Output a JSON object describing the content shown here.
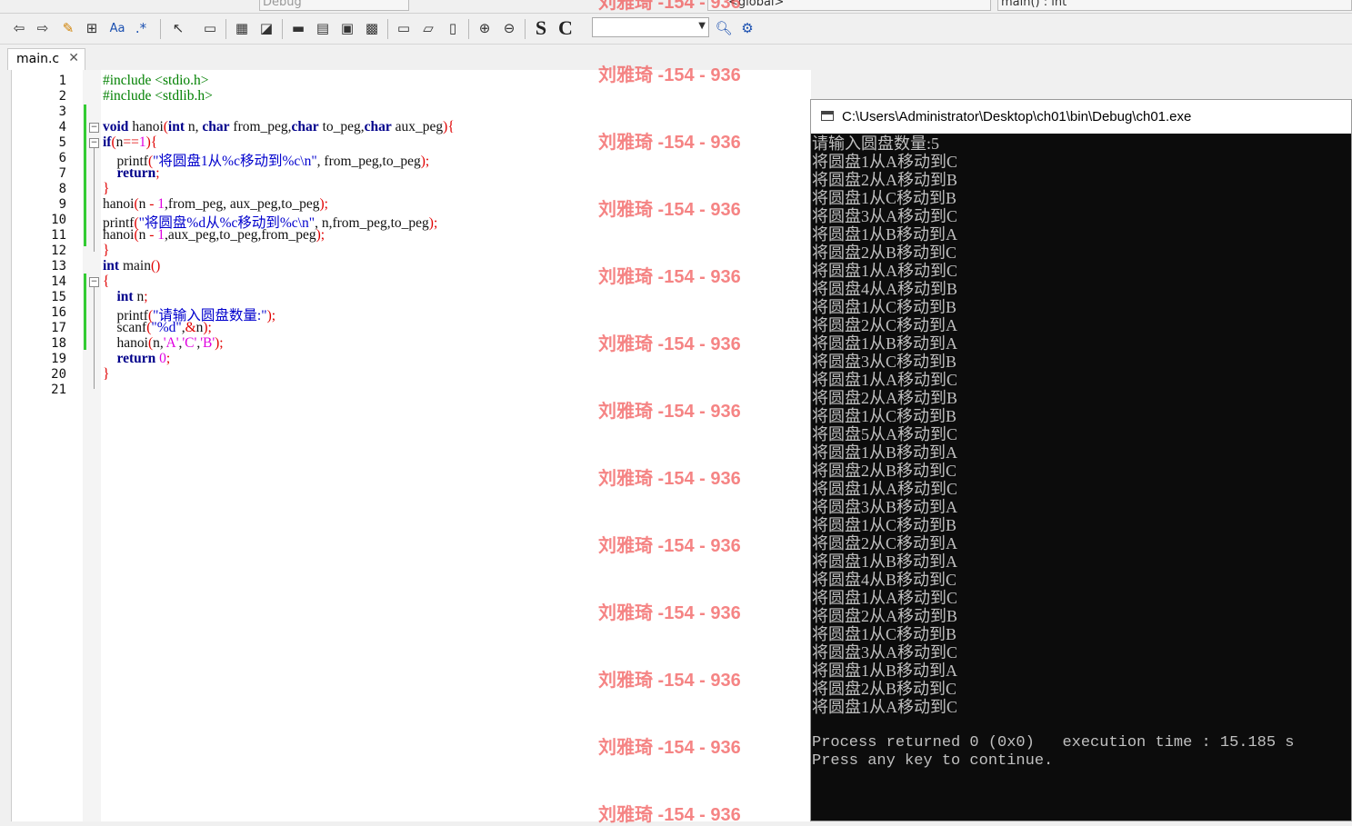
{
  "toolbar1": {
    "build_target": "Debug",
    "scope": "<global>",
    "function": "main() : int"
  },
  "toolbar2": {
    "search_combo": "",
    "buttons": [
      "S",
      "C"
    ]
  },
  "tab": {
    "label": "main.c",
    "close": "✕"
  },
  "editor": {
    "line_numbers": [
      "1",
      "2",
      "3",
      "4",
      "5",
      "6",
      "7",
      "8",
      "9",
      "10",
      "11",
      "12",
      "13",
      "14",
      "15",
      "16",
      "17",
      "18",
      "19",
      "20",
      "21"
    ]
  },
  "watermark": "刘雅琦 -154 - 936",
  "console": {
    "title": "C:\\Users\\Administrator\\Desktop\\ch01\\bin\\Debug\\ch01.exe",
    "lines": [
      "请输入圆盘数量:5",
      "将圆盘1从A移动到C",
      "将圆盘2从A移动到B",
      "将圆盘1从C移动到B",
      "将圆盘3从A移动到C",
      "将圆盘1从B移动到A",
      "将圆盘2从B移动到C",
      "将圆盘1从A移动到C",
      "将圆盘4从A移动到B",
      "将圆盘1从C移动到B",
      "将圆盘2从C移动到A",
      "将圆盘1从B移动到A",
      "将圆盘3从C移动到B",
      "将圆盘1从A移动到C",
      "将圆盘2从A移动到B",
      "将圆盘1从C移动到B",
      "将圆盘5从A移动到C",
      "将圆盘1从B移动到A",
      "将圆盘2从B移动到C",
      "将圆盘1从A移动到C",
      "将圆盘3从B移动到A",
      "将圆盘1从C移动到B",
      "将圆盘2从C移动到A",
      "将圆盘1从B移动到A",
      "将圆盘4从B移动到C",
      "将圆盘1从A移动到C",
      "将圆盘2从A移动到B",
      "将圆盘1从C移动到B",
      "将圆盘3从A移动到C",
      "将圆盘1从B移动到A",
      "将圆盘2从B移动到C",
      "将圆盘1从A移动到C"
    ],
    "process_line": "Process returned 0 (0x0)   execution time : 15.185 s",
    "press_line": "Press any key to continue."
  }
}
